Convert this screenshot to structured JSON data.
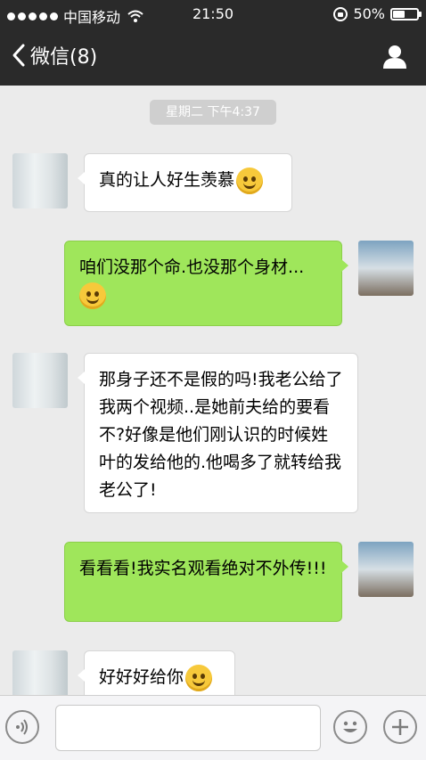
{
  "status_bar": {
    "carrier": "中国移动",
    "time": "21:50",
    "battery": "50%",
    "battery_level": 0.5
  },
  "nav": {
    "back_label": "微信(8)",
    "back_icon": "chevron-left-icon",
    "contact_icon": "person-icon"
  },
  "chat": {
    "timestamp": "星期二 下午4:37",
    "messages": [
      {
        "side": "in",
        "text": "真的让人好生羡慕",
        "emoji": "blushing-face"
      },
      {
        "side": "out",
        "text": "咱们没那个命.也没那个身材...",
        "emoji": "grinning-face"
      },
      {
        "side": "in",
        "text": "那身子还不是假的吗!我老公给了我两个视频..是她前夫给的要看不?好像是他们刚认识的时候姓叶的发给他的.他喝多了就转给我老公了!"
      },
      {
        "side": "out",
        "text": "看看看!我实名观看绝对不外传!!!"
      },
      {
        "side": "in",
        "text": "好好好给你",
        "emoji": "winking-tongue-face"
      }
    ]
  },
  "input_bar": {
    "voice_icon": "voice-icon",
    "emoji_icon": "smiley-icon",
    "plus_icon": "plus-icon"
  },
  "colors": {
    "outgoing_bubble": "#9fe65b",
    "incoming_bubble": "#ffffff",
    "bars": "#2a2a2a",
    "background": "#ebebeb"
  }
}
